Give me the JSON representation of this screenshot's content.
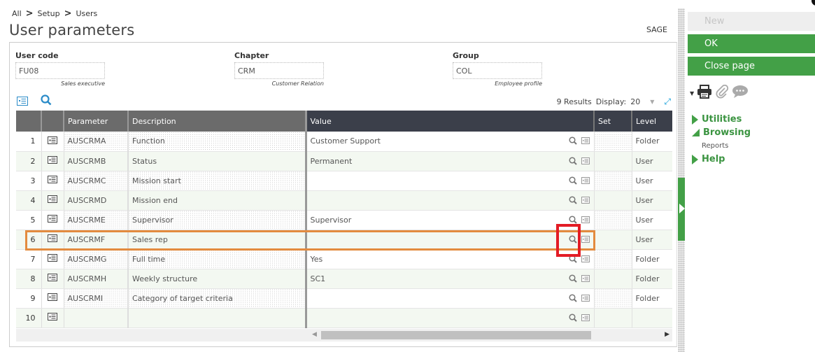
{
  "breadcrumb": [
    "All",
    "Setup",
    "Users"
  ],
  "breadcrumb_separator": ">",
  "page_title": "User parameters",
  "company": "SAGE",
  "fields": {
    "user_code": {
      "label": "User code",
      "value": "FU08",
      "hint": "Sales executive"
    },
    "chapter": {
      "label": "Chapter",
      "value": "CRM",
      "hint": "Customer Relation"
    },
    "group": {
      "label": "Group",
      "value": "COL",
      "hint": "Employee profile"
    }
  },
  "grid": {
    "results_text": "9 Results",
    "display_label": "Display:",
    "display_value": "20",
    "columns": [
      "",
      "",
      "Parameter",
      "Description",
      "Value",
      "Set",
      "Level"
    ],
    "rows": [
      {
        "n": "1",
        "parameter": "AUSCRMA",
        "description": "Function",
        "value": "Customer Support",
        "set": "",
        "level": "Folder"
      },
      {
        "n": "2",
        "parameter": "AUSCRMB",
        "description": "Status",
        "value": "Permanent",
        "set": "",
        "level": "User"
      },
      {
        "n": "3",
        "parameter": "AUSCRMC",
        "description": "Mission start",
        "value": "",
        "set": "",
        "level": "User"
      },
      {
        "n": "4",
        "parameter": "AUSCRMD",
        "description": "Mission end",
        "value": "",
        "set": "",
        "level": "User"
      },
      {
        "n": "5",
        "parameter": "AUSCRME",
        "description": "Supervisor",
        "value": "Supervisor",
        "set": "",
        "level": "User"
      },
      {
        "n": "6",
        "parameter": "AUSCRMF",
        "description": "Sales rep",
        "value": "",
        "set": "",
        "level": "User"
      },
      {
        "n": "7",
        "parameter": "AUSCRMG",
        "description": "Full time",
        "value": "Yes",
        "set": "",
        "level": "Folder"
      },
      {
        "n": "8",
        "parameter": "AUSCRMH",
        "description": "Weekly structure",
        "value": "SC1",
        "set": "",
        "level": "Folder"
      },
      {
        "n": "9",
        "parameter": "AUSCRMI",
        "description": "Category of target criteria",
        "value": "",
        "set": "",
        "level": "Folder"
      },
      {
        "n": "10",
        "parameter": "",
        "description": "",
        "value": "",
        "set": "",
        "level": ""
      }
    ]
  },
  "right_panel": {
    "buttons": {
      "new": "New",
      "ok": "OK",
      "close": "Close page"
    },
    "menu": [
      {
        "label": "Utilities",
        "expanded": false
      },
      {
        "label": "Browsing",
        "expanded": true,
        "children": [
          "Reports"
        ]
      },
      {
        "label": "Help",
        "expanded": false
      }
    ]
  },
  "colors": {
    "accent_green": "#43a047",
    "highlight_orange": "#e38b3f",
    "highlight_red": "#e31c25",
    "header_dark": "#3b3f4a",
    "header_gray": "#6b6b6b"
  }
}
